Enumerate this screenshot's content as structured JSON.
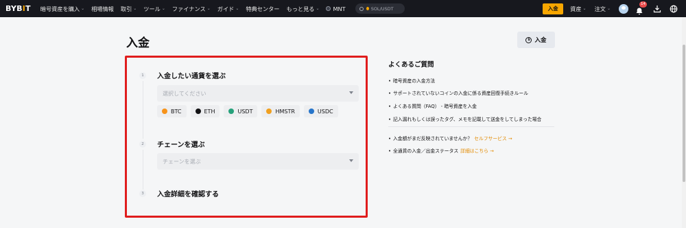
{
  "nav": {
    "logo_main": "BYB",
    "logo_accent": "I",
    "logo_end": "T",
    "items": [
      {
        "label": "暗号資産を購入",
        "has_chevron": true
      },
      {
        "label": "相場情報",
        "has_chevron": false
      },
      {
        "label": "取引",
        "has_chevron": true
      },
      {
        "label": "ツール",
        "has_chevron": true
      },
      {
        "label": "ファイナンス",
        "has_chevron": true
      },
      {
        "label": "ガイド",
        "has_chevron": true
      },
      {
        "label": "特典センター",
        "has_chevron": false
      },
      {
        "label": "もっと見る",
        "has_chevron": true
      }
    ],
    "mnt_label": "MNT",
    "search_placeholder": "SOL/USDT",
    "deposit_label": "入金",
    "assets_label": "資産",
    "orders_label": "注文",
    "notification_count": "14"
  },
  "page": {
    "title": "入金",
    "side_deposit_label": "入金"
  },
  "form": {
    "steps": [
      {
        "num": "1",
        "title": "入金したい通貨を選ぶ",
        "placeholder": "選択してください"
      },
      {
        "num": "2",
        "title": "チェーンを選ぶ",
        "placeholder": "チェーンを選ぶ"
      },
      {
        "num": "3",
        "title": "入金詳細を確認する"
      }
    ],
    "coins": [
      {
        "label": "BTC",
        "color": "#f7931a"
      },
      {
        "label": "ETH",
        "color": "#121214"
      },
      {
        "label": "USDT",
        "color": "#26a17b"
      },
      {
        "label": "HMSTR",
        "color": "#f0a020"
      },
      {
        "label": "USDC",
        "color": "#2775ca"
      }
    ]
  },
  "faq": {
    "title": "よくあるご質問",
    "items": [
      {
        "text": "暗号資産の入金方法"
      },
      {
        "text": "サポートされていないコインの入金に係る資産回復手続きルール"
      },
      {
        "text": "よくある質問（FAQ） - 暗号資産を入金"
      },
      {
        "text": "記入漏れもしくは誤ったタグ、メモを記載して送金をしてしまった場合"
      }
    ],
    "extra": [
      {
        "text": "入金額がまだ反映されていませんか？",
        "link": "セルフサービス →"
      },
      {
        "text": "全通貨の入金／出金ステータス",
        "link": "詳細はこちら →"
      }
    ]
  },
  "colors": {
    "accent": "#f7a600",
    "highlight_border": "#e01d1d",
    "link": "#e28a00"
  }
}
